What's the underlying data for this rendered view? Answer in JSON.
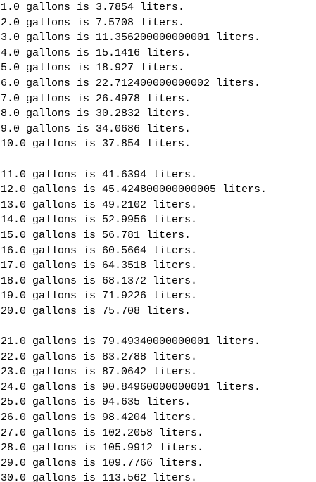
{
  "console": {
    "blocks": [
      {
        "lines": [
          "1.0 gallons is 3.7854 liters.",
          "2.0 gallons is 7.5708 liters.",
          "3.0 gallons is 11.356200000000001 liters.",
          "4.0 gallons is 15.1416 liters.",
          "5.0 gallons is 18.927 liters.",
          "6.0 gallons is 22.712400000000002 liters.",
          "7.0 gallons is 26.4978 liters.",
          "8.0 gallons is 30.2832 liters.",
          "9.0 gallons is 34.0686 liters.",
          "10.0 gallons is 37.854 liters."
        ]
      },
      {
        "lines": [
          "11.0 gallons is 41.6394 liters.",
          "12.0 gallons is 45.424800000000005 liters.",
          "13.0 gallons is 49.2102 liters.",
          "14.0 gallons is 52.9956 liters.",
          "15.0 gallons is 56.781 liters.",
          "16.0 gallons is 60.5664 liters.",
          "17.0 gallons is 64.3518 liters.",
          "18.0 gallons is 68.1372 liters.",
          "19.0 gallons is 71.9226 liters.",
          "20.0 gallons is 75.708 liters."
        ]
      },
      {
        "lines": [
          "21.0 gallons is 79.49340000000001 liters.",
          "22.0 gallons is 83.2788 liters.",
          "23.0 gallons is 87.0642 liters.",
          "24.0 gallons is 90.84960000000001 liters.",
          "25.0 gallons is 94.635 liters.",
          "26.0 gallons is 98.4204 liters.",
          "27.0 gallons is 102.2058 liters.",
          "28.0 gallons is 105.9912 liters.",
          "29.0 gallons is 109.7766 liters.",
          "30.0 gallons is 113.562 liters."
        ]
      }
    ]
  }
}
